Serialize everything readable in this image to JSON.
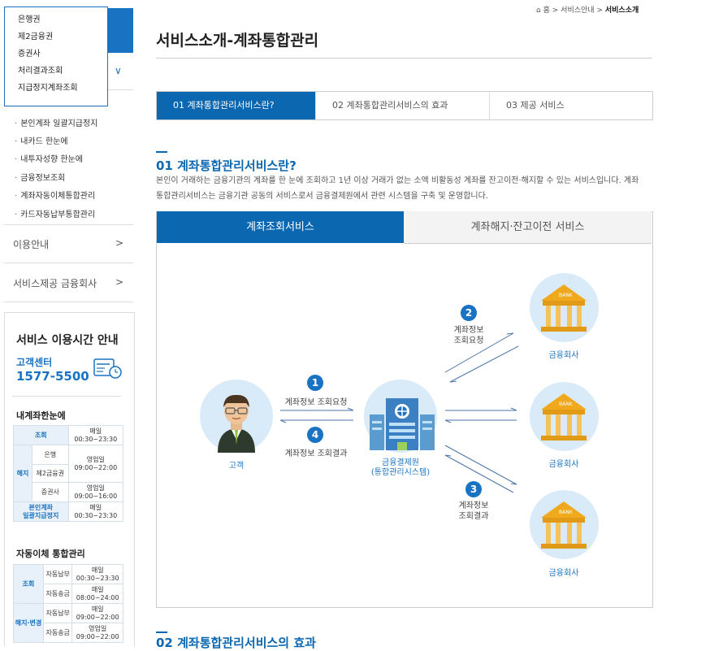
{
  "dropdown": [
    "은행권",
    "제2금융권",
    "증권사",
    "처리결과조회",
    "지급정지계좌조회"
  ],
  "sidebar": {
    "sub_items": [
      "본인계좌 일괄지급정지",
      "내카드 한눈에",
      "내투자성향 한눈에",
      "금융정보조회",
      "계좌자동이체통합관리",
      "카드자동납부통합관리"
    ],
    "menu": [
      {
        "label": "이용안내",
        "arrow": ">"
      },
      {
        "label": "서비스제공 금융회사",
        "arrow": ">"
      }
    ],
    "chevron": "∨",
    "service_title": "서비스 이용시간 안내",
    "cs_label": "고객센터",
    "cs_number": "1577-5500",
    "section1_title": "내계좌한눈에",
    "section2_title": "자동이체 통합관리"
  },
  "table1": {
    "r1": [
      "조회",
      "매일",
      "00:30~23:30"
    ],
    "r2_head": "해지",
    "r2": [
      "은행",
      "영업일",
      "09:00~22:00"
    ],
    "r3": [
      "제2금융권"
    ],
    "r4": [
      "증권사",
      "영업일",
      "09:00~16:00"
    ],
    "r5": [
      "본인계좌",
      "일괄지급정지",
      "매일",
      "00:30~23:30"
    ]
  },
  "table2": {
    "g1": "조회",
    "r1": [
      "자동납부",
      "매일",
      "00:30~23:30"
    ],
    "r2": [
      "자동송금",
      "매일",
      "08:00~24:00"
    ],
    "g2": "해지·변경",
    "r3": [
      "자동납부",
      "매일",
      "09:00~22:00"
    ],
    "r4": [
      "자동송금",
      "영업일",
      "09:00~22:00"
    ]
  },
  "breadcrumb": {
    "home": "홈",
    "sep": ">",
    "b1": "서비스안내",
    "b2": "서비스소개"
  },
  "page_title": "서비스소개-계좌통합관리",
  "tabs": [
    "01 계좌통합관리서비스란?",
    "02 계좌통합관리서비스의 효과",
    "03 제공 서비스"
  ],
  "section": {
    "title": "01 계좌통합관리서비스란?",
    "desc": "본인이 거래하는 금융기관의 계좌를 한 눈에 조회하고 1년 이상 거래가 없는 소액 비활동성 계좌를 잔고이전·해지할 수 있는 서비스입니다. 계좌통합관리서비스는 금융기관 공동의 서비스로서 금융결제원에서 관련 시스템을 구축 및 운영합니다."
  },
  "panel_tabs": [
    "계좌조회서비스",
    "계좌해지·잔고이전 서비스"
  ],
  "diagram": {
    "customer": "고객",
    "center_line1": "금융결제원",
    "center_line2": "(통합관리시스템)",
    "bank": "금융회사",
    "bank_sign": "BANK",
    "step1": {
      "num": "1",
      "label": "계좌정보 조회요청"
    },
    "step2": {
      "num": "2",
      "label1": "계좌정보",
      "label2": "조회요청"
    },
    "step3": {
      "num": "3",
      "label1": "계좌정보",
      "label2": "조회결과"
    },
    "step4": {
      "num": "4",
      "label": "계좌정보 조회결과"
    }
  },
  "next_section_title": "02 계좌통합관리서비스의 효과",
  "colors": {
    "primary": "#0a67b0",
    "accent": "#1a73c2"
  }
}
